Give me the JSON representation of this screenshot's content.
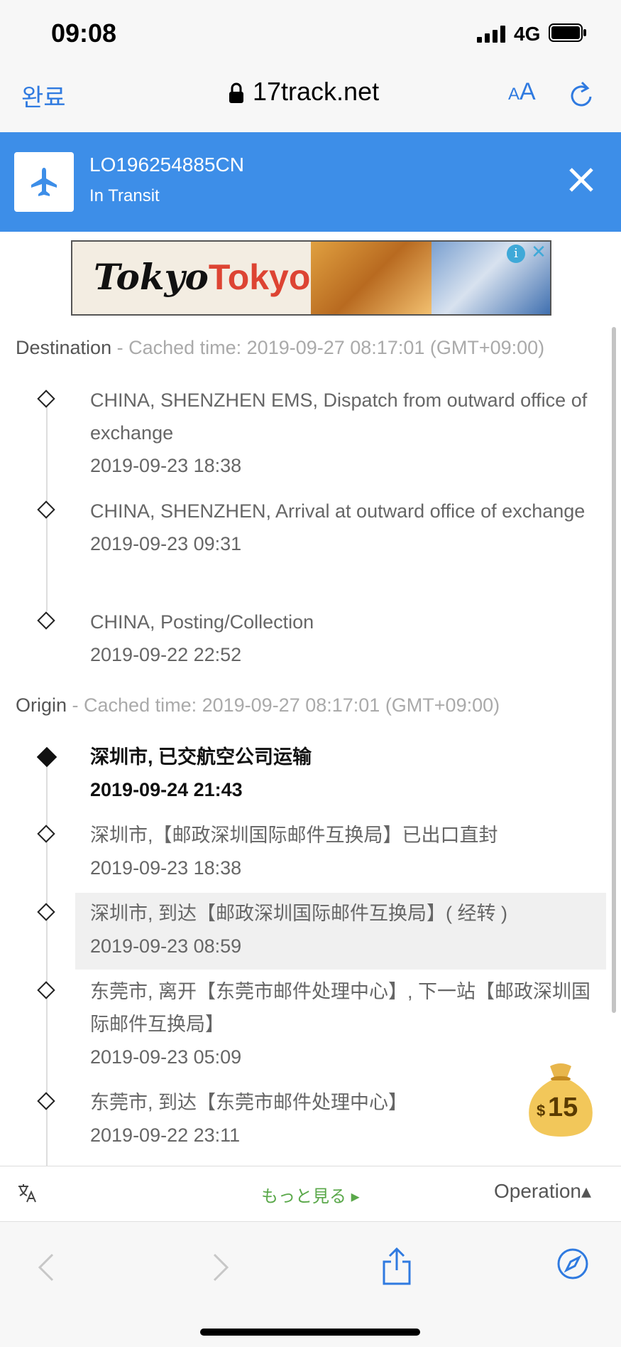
{
  "status_bar": {
    "time": "09:08",
    "network": "4G"
  },
  "url_bar": {
    "done_label": "완료",
    "domain": "17track.net",
    "text_size_small": "A",
    "text_size_large": "A"
  },
  "banner": {
    "tracking_number": "LO196254885CN",
    "status": "In Transit"
  },
  "ad": {
    "logo_part1": "Tokyo",
    "logo_part2": "Tokyo",
    "info_icon": "i",
    "close_icon": "✕"
  },
  "destination": {
    "label": "Destination",
    "cached": " - Cached time: 2019-09-27 08:17:01 (GMT+09:00)",
    "events": [
      {
        "text": "CHINA, SHENZHEN EMS, Dispatch from outward office of exchange",
        "time": "2019-09-23 18:38"
      },
      {
        "text": "CHINA, SHENZHEN, Arrival at outward office of exchange",
        "time": "2019-09-23 09:31"
      },
      {
        "text": "CHINA, Posting/Collection",
        "time": "2019-09-22 22:52"
      }
    ]
  },
  "origin": {
    "label": "Origin",
    "cached": " - Cached time: 2019-09-27 08:17:01 (GMT+09:00)",
    "events": [
      {
        "text": "深圳市, 已交航空公司运输",
        "time": "2019-09-24 21:43"
      },
      {
        "text": "深圳市,【邮政深圳国际邮件互换局】已出口直封",
        "time": "2019-09-23 18:38"
      },
      {
        "text": "深圳市, 到达【邮政深圳国际邮件互换局】( 经转 )",
        "time": "2019-09-23 08:59"
      },
      {
        "text": "东莞市, 离开【东莞市邮件处理中心】, 下一站【邮政深圳国际邮件互换局】",
        "time": "2019-09-23 05:09"
      },
      {
        "text": "东莞市, 到达【东莞市邮件处理中心】",
        "time": "2019-09-22 23:11"
      }
    ]
  },
  "reward": {
    "currency": "$",
    "amount": "15"
  },
  "toolbar": {
    "more_label": "もっと見る ▸",
    "operation_label": "Operation▴"
  },
  "colors": {
    "accent": "#3d8ee8",
    "link": "#2f7ae0",
    "more": "#5aa84a"
  }
}
